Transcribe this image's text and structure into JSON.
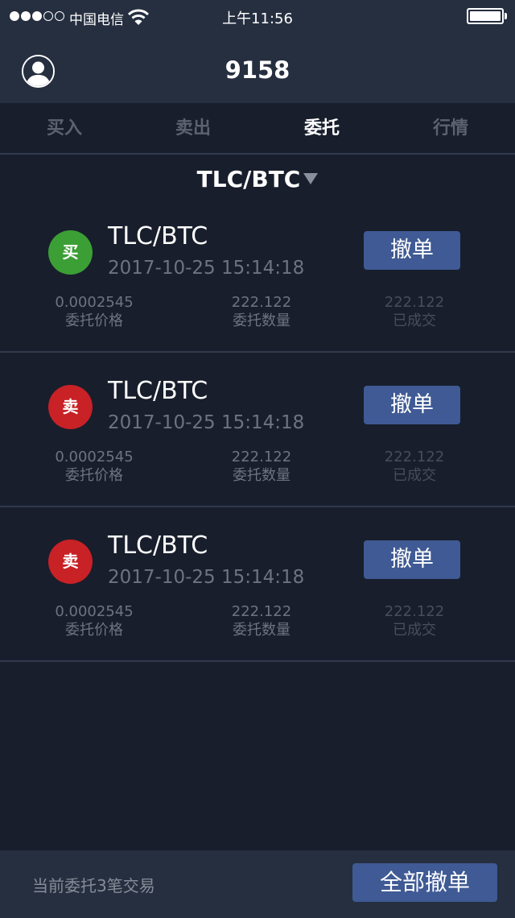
{
  "status_bar": {
    "carrier": "中国电信",
    "time": "上午11:56",
    "signal_dots_filled": 3,
    "signal_dots_total": 5,
    "battery_level": 1.0
  },
  "nav": {
    "title": "9158",
    "avatar_icon": "user-avatar-icon"
  },
  "tabs": [
    {
      "label": "买入",
      "active": false
    },
    {
      "label": "卖出",
      "active": false
    },
    {
      "label": "委托",
      "active": true
    },
    {
      "label": "行情",
      "active": false
    }
  ],
  "pair_selector": {
    "label": "TLC/BTC"
  },
  "orders": [
    {
      "side_label": "买",
      "side": "buy",
      "pair": "TLC/BTC",
      "datetime": "2017-10-25   15:14:18",
      "cancel_label": "撤单",
      "price_value": "0.0002545",
      "price_label": "委托价格",
      "qty_value": "222.122",
      "qty_label": "委托数量",
      "filled_value": "222.122",
      "filled_label": "已成交"
    },
    {
      "side_label": "卖",
      "side": "sell",
      "pair": "TLC/BTC",
      "datetime": "2017-10-25   15:14:18",
      "cancel_label": "撤单",
      "price_value": "0.0002545",
      "price_label": "委托价格",
      "qty_value": "222.122",
      "qty_label": "委托数量",
      "filled_value": "222.122",
      "filled_label": "已成交"
    },
    {
      "side_label": "卖",
      "side": "sell",
      "pair": "TLC/BTC",
      "datetime": "2017-10-25   15:14:18",
      "cancel_label": "撤单",
      "price_value": "0.0002545",
      "price_label": "委托价格",
      "qty_value": "222.122",
      "qty_label": "委托数量",
      "filled_value": "222.122",
      "filled_label": "已成交"
    }
  ],
  "footer": {
    "info": "当前委托3笔交易",
    "cancel_all_label": "全部撤单"
  },
  "colors": {
    "background": "#181e2c",
    "bar": "#262f40",
    "accent_button": "#3f5a94",
    "buy": "#3b9f35",
    "sell": "#c82126"
  }
}
